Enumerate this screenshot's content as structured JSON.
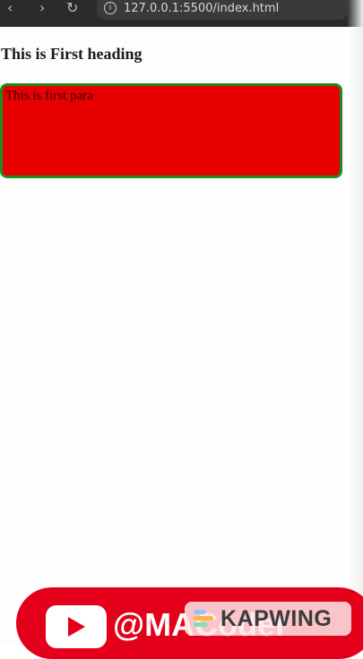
{
  "browser": {
    "back_icon": "‹",
    "forward_icon": "›",
    "reload_icon": "↻",
    "address": "127.0.0.1:5500/index.html",
    "info_icon": "i"
  },
  "page": {
    "heading": "This is First heading",
    "paragraph": "This is first para",
    "colors": {
      "para_background": "#e60000",
      "para_border": "#1f8a1f"
    }
  },
  "overlay": {
    "youtube_handle": "@MACoder",
    "watermark": "KAPWING"
  }
}
